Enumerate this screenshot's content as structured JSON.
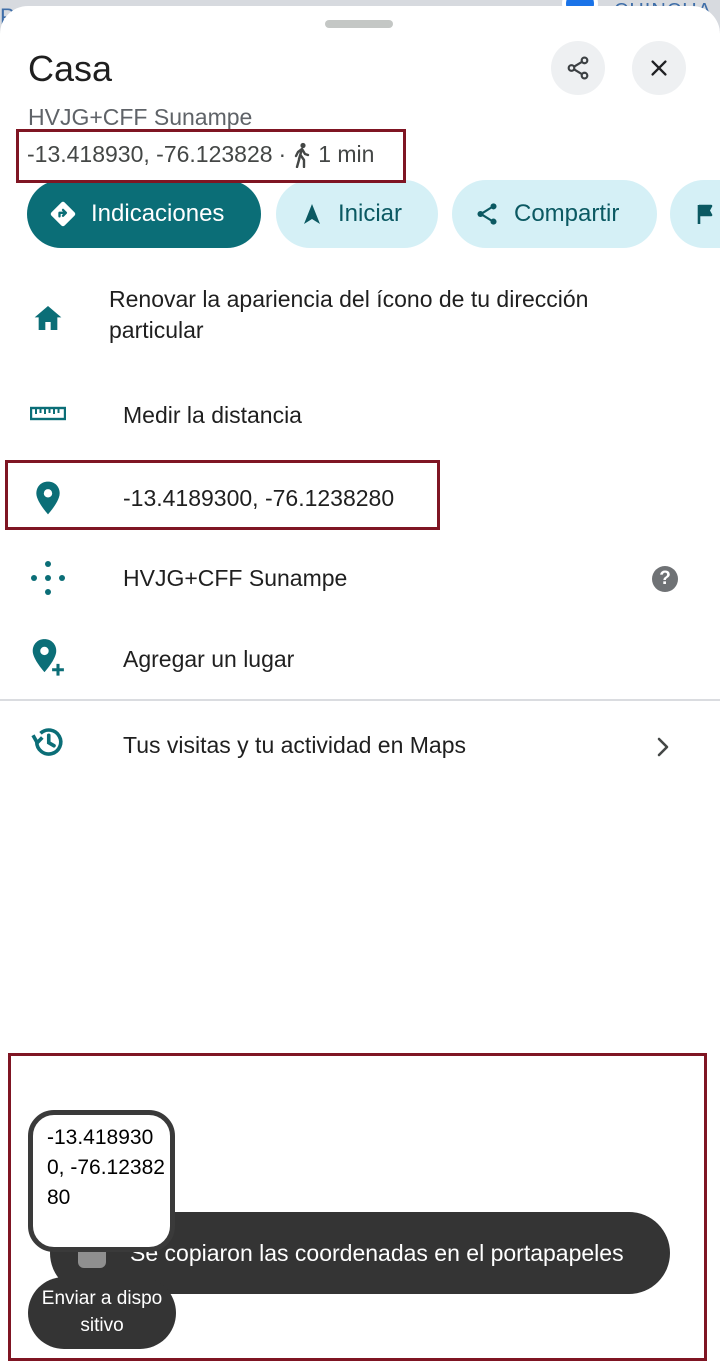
{
  "map": {
    "text_left": "PR",
    "text_right": "CHINCHA"
  },
  "place": {
    "title": "Casa",
    "plus_code_subtitle": "HVJG+CFF Sunampe",
    "coords": "-13.418930, -76.123828",
    "separator": "·",
    "walk_time": "1 min"
  },
  "actions": [
    {
      "label": "Indicaciones",
      "icon": "directions-icon"
    },
    {
      "label": "Iniciar",
      "icon": "navigation-arrow-icon"
    },
    {
      "label": "Compartir",
      "icon": "share-icon"
    },
    {
      "label": "",
      "icon": "flag-icon"
    }
  ],
  "rows": {
    "home": "Renovar la apariencia del ícono de tu dirección particular",
    "measure": "Medir la distancia",
    "coordinates": "-13.4189300, -76.1238280",
    "plus_code": "HVJG+CFF Sunampe",
    "add_place": "Agregar un lugar",
    "activity": "Tus visitas y tu actividad en Maps"
  },
  "toast": {
    "message": "Se copiaron las coordenadas en el portapapeles",
    "clip_preview": "-13.4189300, -76.1238280",
    "send_label": "Enviar a dispositivo"
  },
  "colors": {
    "primary": "#0b6e77",
    "chip_secondary": "#d5f0f6",
    "annotation": "#7f1523"
  }
}
